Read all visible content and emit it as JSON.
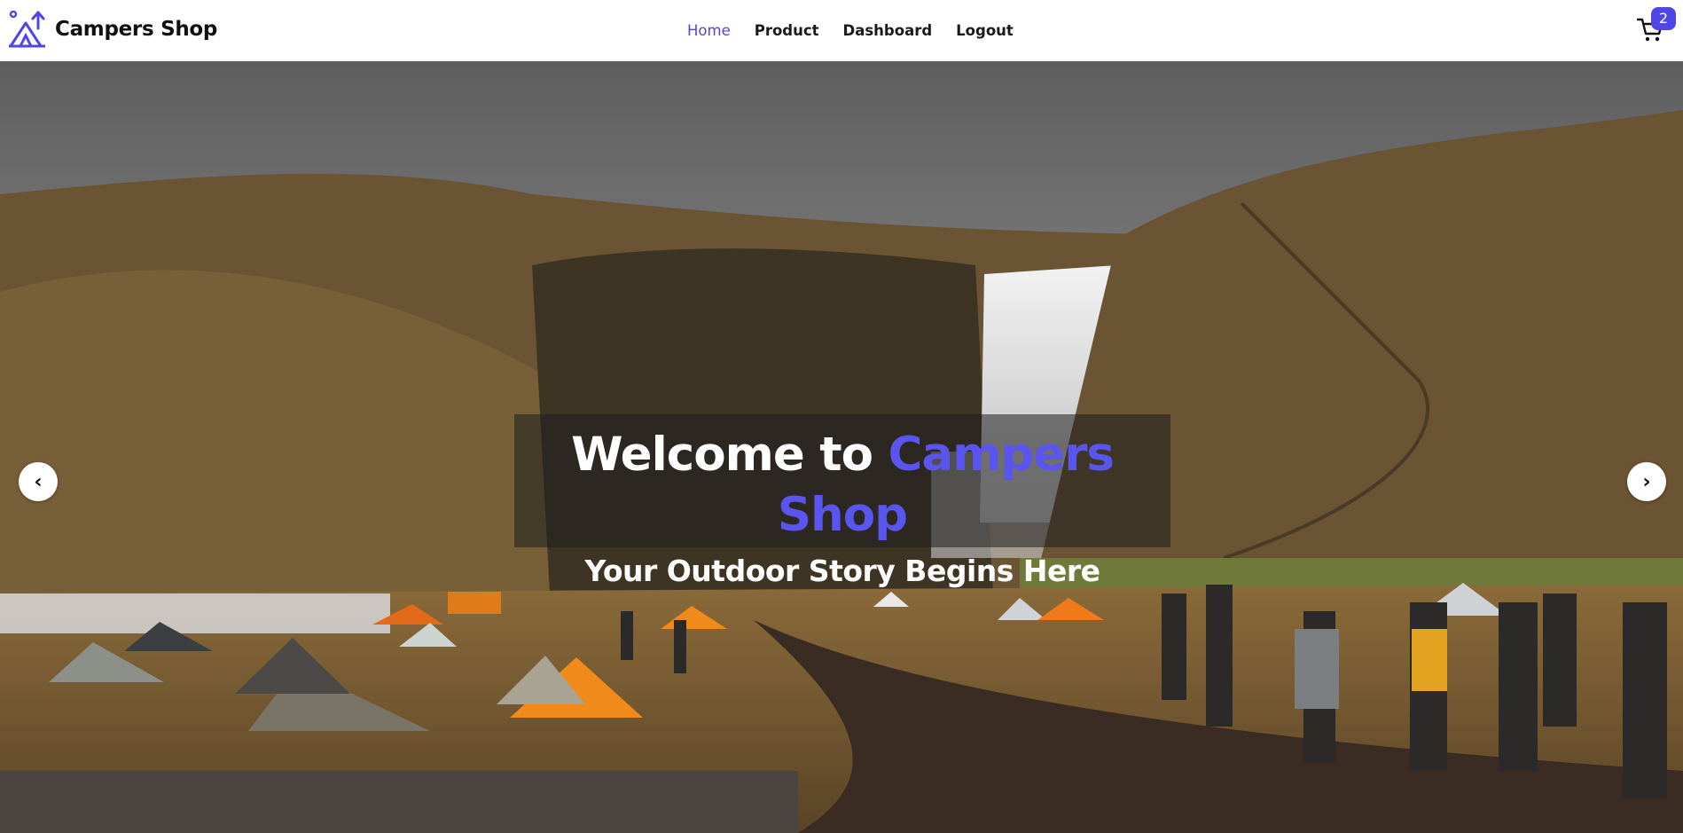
{
  "brand": {
    "name": "Campers Shop",
    "logo_icon": "tent-logo-icon",
    "color": "#4f46e5"
  },
  "nav": {
    "items": [
      {
        "label": "Home",
        "active": true
      },
      {
        "label": "Product",
        "active": false
      },
      {
        "label": "Dashboard",
        "active": false
      },
      {
        "label": "Logout",
        "active": false
      }
    ]
  },
  "cart": {
    "icon": "cart-icon",
    "count": "2"
  },
  "hero": {
    "title_prefix": "Welcome to ",
    "title_accent": "Campers Shop",
    "subtitle": "Your Outdoor Story Begins Here",
    "prev_icon": "‹",
    "next_icon": "›"
  },
  "colors": {
    "accent": "#4f46e5",
    "title_accent": "#5b55f0",
    "caption_bg": "rgba(30,30,30,0.55)"
  }
}
